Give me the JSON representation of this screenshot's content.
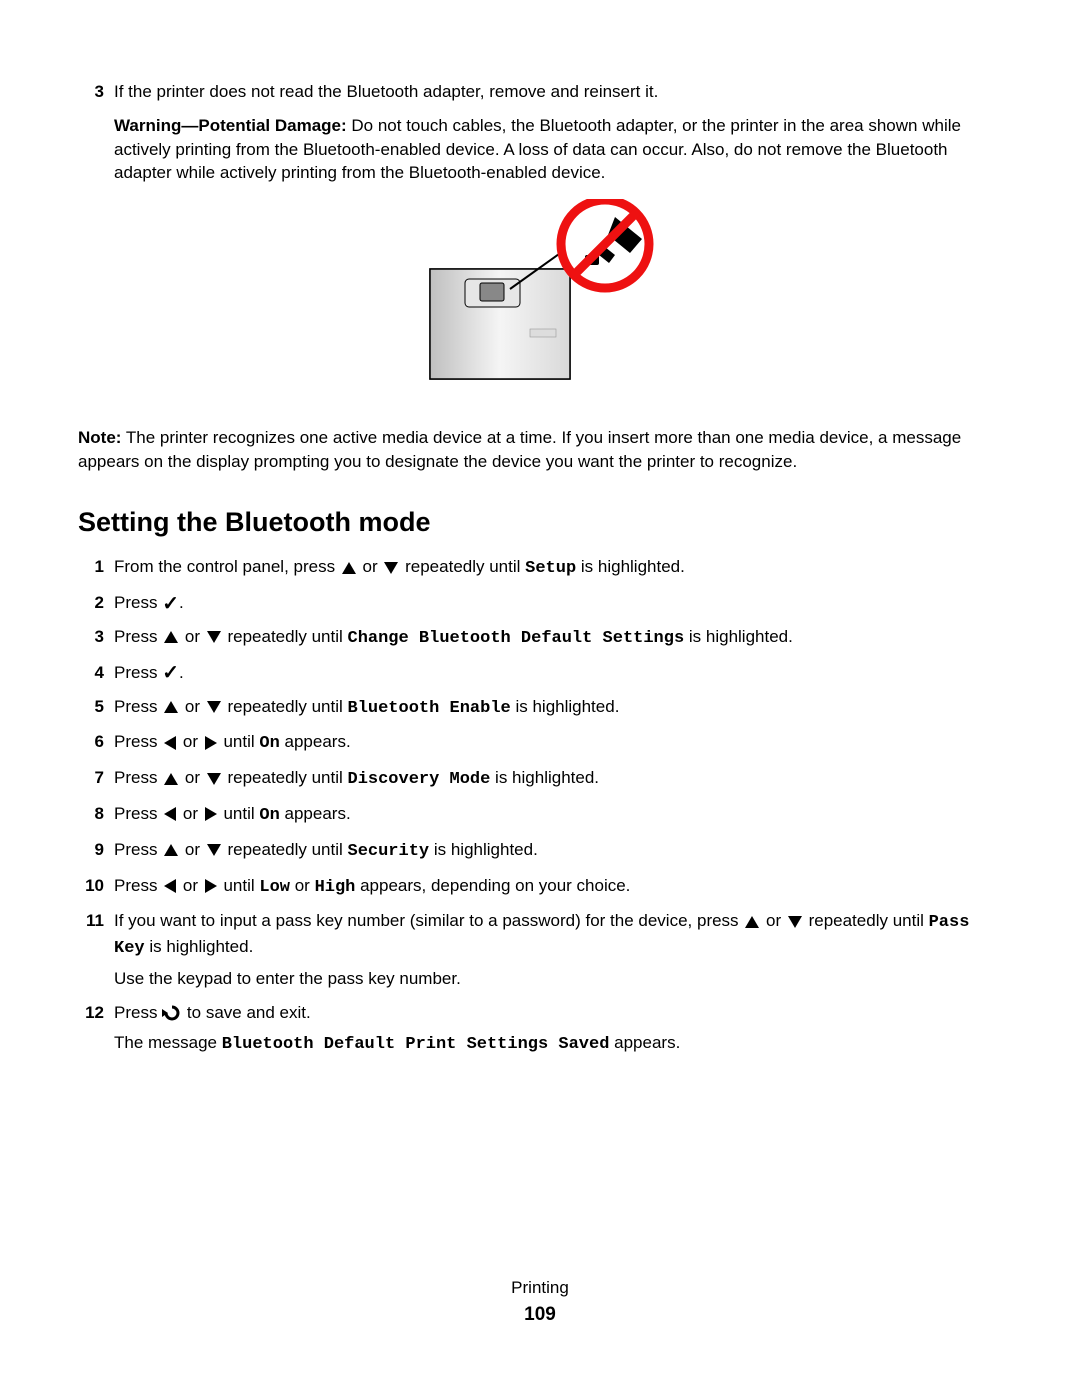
{
  "intro": {
    "num": "3",
    "text": "If the printer does not read the Bluetooth adapter, remove and reinsert it."
  },
  "warning": {
    "label": "Warning—Potential Damage:",
    "text": " Do not touch cables, the Bluetooth adapter, or the printer in the area shown while actively printing from the Bluetooth-enabled device. A loss of data can occur. Also, do not remove the Bluetooth adapter while actively printing from the Bluetooth-enabled device."
  },
  "note": {
    "label": "Note:",
    "text": " The printer recognizes one active media device at a time. If you insert more than one media device, a message appears on the display prompting you to designate the device you want the printer to recognize."
  },
  "heading": "Setting the Bluetooth mode",
  "steps": {
    "s1": {
      "num": "1",
      "a": "From the control panel, press ",
      "b": " or ",
      "c": " repeatedly until ",
      "setup": "Setup",
      "d": " is highlighted."
    },
    "s2": {
      "num": "2",
      "a": "Press ",
      "b": "."
    },
    "s3": {
      "num": "3",
      "a": "Press ",
      "b": " or ",
      "c": " repeatedly until ",
      "cbds": "Change Bluetooth Default Settings",
      "d": " is highlighted."
    },
    "s4": {
      "num": "4",
      "a": "Press ",
      "b": "."
    },
    "s5": {
      "num": "5",
      "a": "Press ",
      "b": " or ",
      "c": " repeatedly until ",
      "be": "Bluetooth Enable",
      "d": " is highlighted."
    },
    "s6": {
      "num": "6",
      "a": "Press ",
      "b": " or ",
      "c": " until ",
      "on": "On",
      "d": " appears."
    },
    "s7": {
      "num": "7",
      "a": "Press ",
      "b": " or ",
      "c": " repeatedly until ",
      "dm": "Discovery Mode",
      "d": " is highlighted."
    },
    "s8": {
      "num": "8",
      "a": "Press ",
      "b": " or ",
      "c": " until ",
      "on": "On",
      "d": " appears."
    },
    "s9": {
      "num": "9",
      "a": "Press ",
      "b": " or ",
      "c": " repeatedly until ",
      "sec": "Security",
      "d": " is highlighted."
    },
    "s10": {
      "num": "10",
      "a": "Press ",
      "b": " or ",
      "c": " until ",
      "low": "Low",
      "or": " or ",
      "high": "High",
      "d": " appears, depending on your choice."
    },
    "s11": {
      "num": "11",
      "a": "If you want to input a pass key number (similar to a password) for the device, press ",
      "b": " or ",
      "c": " repeatedly until ",
      "pk": "Pass Key",
      "d": " is highlighted.",
      "sub": "Use the keypad to enter the pass key number."
    },
    "s12": {
      "num": "12",
      "a": "Press ",
      "b": " to save and exit.",
      "msga": "The message ",
      "msg": "Bluetooth Default Print Settings Saved",
      "msgb": " appears."
    }
  },
  "footer": {
    "section": "Printing",
    "page": "109"
  }
}
